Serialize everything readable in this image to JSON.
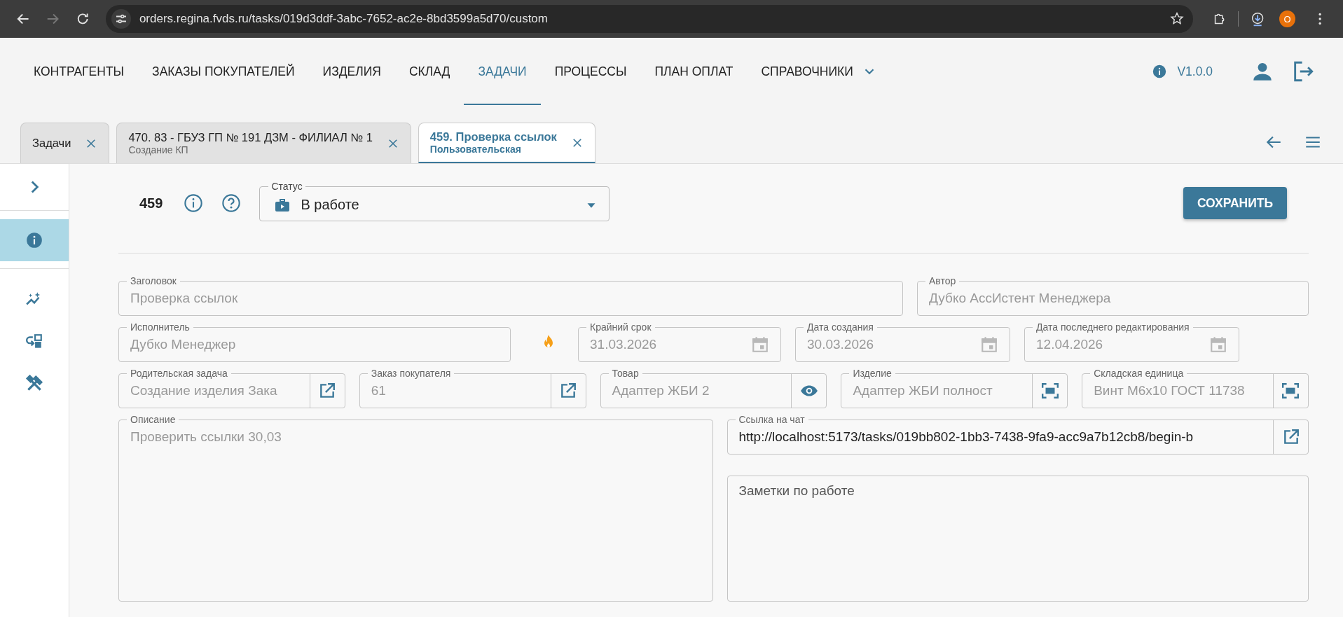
{
  "browser": {
    "url": "orders.regina.fvds.ru/tasks/019d3ddf-3abc-7652-ac2e-8bd3599a5d70/custom",
    "profile": "O"
  },
  "nav": {
    "items": [
      {
        "label": "КОНТРАГЕНТЫ",
        "selected": false,
        "dropdown": false
      },
      {
        "label": "ЗАКАЗЫ ПОКУПАТЕЛЕЙ",
        "selected": false,
        "dropdown": false
      },
      {
        "label": "ИЗДЕЛИЯ",
        "selected": false,
        "dropdown": false
      },
      {
        "label": "СКЛАД",
        "selected": false,
        "dropdown": false
      },
      {
        "label": "ЗАДАЧИ",
        "selected": true,
        "dropdown": false
      },
      {
        "label": "ПРОЦЕССЫ",
        "selected": false,
        "dropdown": false
      },
      {
        "label": "ПЛАН ОПЛАТ",
        "selected": false,
        "dropdown": false
      },
      {
        "label": "СПРАВОЧНИКИ",
        "selected": false,
        "dropdown": true
      }
    ],
    "version": "V1.0.0"
  },
  "tabs": [
    {
      "title": "Задачи",
      "selected": false
    },
    {
      "title": "470. 83 - ГБУЗ ГП № 191 ДЗМ - ФИЛИАЛ № 1",
      "subtitle": "Создание КП",
      "selected": false
    },
    {
      "title": "459. Проверка ссылок",
      "subtitle": "Пользовательская",
      "selected": true
    }
  ],
  "sidebar": {
    "items": [
      {
        "kind": "info",
        "selected": true
      },
      {
        "kind": "chart",
        "selected": false
      },
      {
        "kind": "swap",
        "selected": false
      },
      {
        "kind": "tools",
        "selected": false
      }
    ]
  },
  "task": {
    "number": "459",
    "status": {
      "label": "Статус",
      "value": "В работе"
    },
    "save": "СОХРАНИТЬ"
  },
  "rows": [
    [
      {
        "label": "Заголовок",
        "value": "Проверка ссылок",
        "disabled": true,
        "kind": "text"
      },
      {
        "label": "Автор",
        "value": "Дубко АссИстент Менеджера",
        "disabled": true,
        "kind": "text"
      }
    ],
    [
      {
        "label": "Исполнитель",
        "value": "Дубко Менеджер",
        "disabled": true,
        "kind": "text"
      },
      {
        "label": "Крайний срок",
        "value": "31.03.2026",
        "disabled": true,
        "kind": "date",
        "urgent": true
      },
      {
        "label": "Дата создания",
        "value": "30.03.2026",
        "disabled": true,
        "kind": "date",
        "urgent": false
      },
      {
        "label": "Дата последнего редактирования",
        "value": "12.04.2026",
        "disabled": true,
        "kind": "date",
        "urgent": false
      }
    ],
    [
      {
        "label": "Родительская задача",
        "value": "Создание изделия Зака",
        "disabled": true,
        "kind": "open"
      },
      {
        "label": "Заказ покупателя",
        "value": "61",
        "disabled": true,
        "kind": "open"
      },
      {
        "label": "Товар",
        "value": "Адаптер ЖБИ 2",
        "disabled": true,
        "kind": "view"
      },
      {
        "label": "Изделие",
        "value": "Адаптер ЖБИ полност",
        "disabled": true,
        "kind": "scan"
      },
      {
        "label": "Складская единица",
        "value": "Винт М6х10  ГОСТ 11738",
        "disabled": true,
        "kind": "scan"
      }
    ]
  ],
  "description": {
    "label": "Описание",
    "value": "Проверить ссылки 30,03",
    "disabled": true
  },
  "chat_link": {
    "label": "Ссылка на чат",
    "value": "http://localhost:5173/tasks/019bb802-1bb3-7438-9fa9-acc9a7b12cb8/begin-b",
    "disabled": false
  },
  "notes": {
    "placeholder": "Заметки по работе"
  }
}
